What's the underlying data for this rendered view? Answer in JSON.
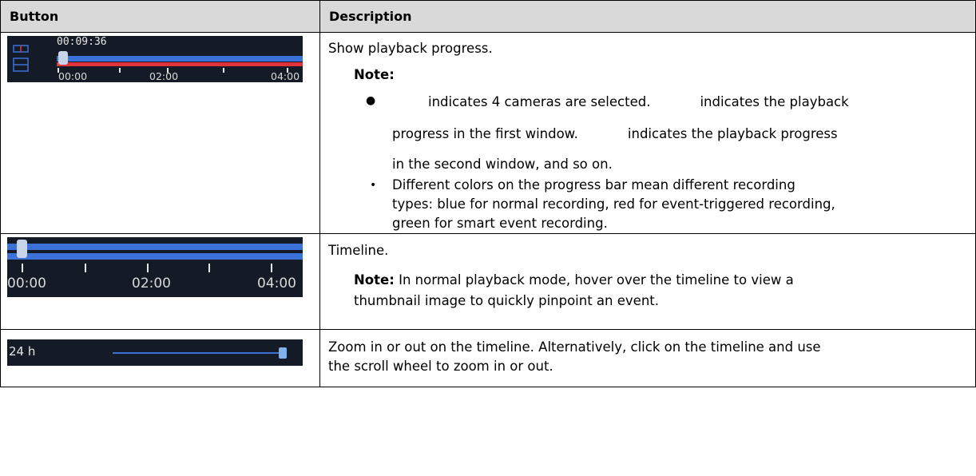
{
  "header": {
    "button": "Button",
    "description": "Description"
  },
  "rows": [
    {
      "image": {
        "time": "00:09:36",
        "ticks": [
          "00:00",
          "02:00",
          "04:00"
        ],
        "grid_icon": "grid-4-icon"
      },
      "main": "Show playback progress.",
      "note_label": "Note:",
      "bullet1_a": "indicates 4 cameras are selected.",
      "bullet1_b": "indicates the playback",
      "bullet1_c": "progress in the first window.",
      "bullet1_d": "indicates the playback progress",
      "bullet1_e": "in the second window, and so on.",
      "bullet2_a": "Different colors on the progress bar mean different recording",
      "bullet2_b": "types: blue for normal recording, red for event-triggered recording,",
      "bullet2_c": "green for smart event recording."
    },
    {
      "image": {
        "ticks": [
          "00:00",
          "02:00",
          "04:00"
        ]
      },
      "main": "Timeline.",
      "note_label": "Note:",
      "note_a": "In normal playback mode, hover over the timeline to view a",
      "note_b": "thumbnail image to quickly pinpoint an event."
    },
    {
      "image": {
        "label": "24 h"
      },
      "main_a": "Zoom in or out on the timeline. Alternatively, click on the timeline and use",
      "main_b": "the scroll wheel to zoom in or out."
    }
  ],
  "colors": {
    "blue": "#3b71d8",
    "red": "#e0343a",
    "dark": "#141b27",
    "header_bg": "#d9d9d9"
  }
}
